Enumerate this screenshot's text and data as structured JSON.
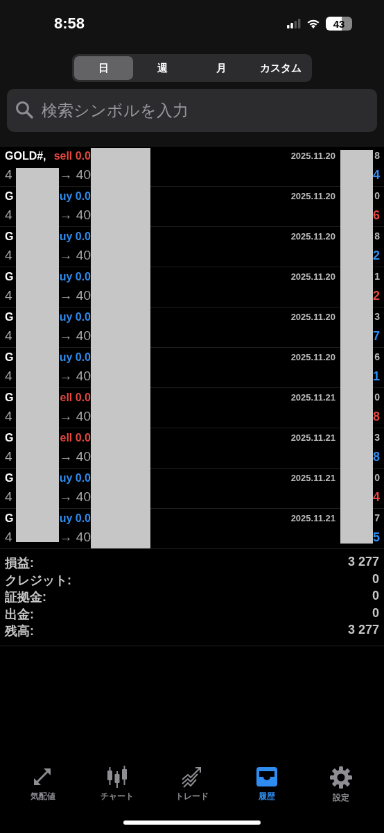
{
  "status_bar": {
    "time": "8:58",
    "battery": "43"
  },
  "period_tabs": [
    {
      "label": "日",
      "selected": true
    },
    {
      "label": "週",
      "selected": false
    },
    {
      "label": "月",
      "selected": false
    },
    {
      "label": "カスタム",
      "selected": false
    }
  ],
  "search": {
    "placeholder": "検索シンボルを入力"
  },
  "deals": [
    {
      "symbol": "GOLD#,",
      "type": "sell 0.0",
      "sell": true,
      "price_open": "4",
      "price_close": "→ 40",
      "date": "2025.11.20",
      "column_4": "8",
      "profit": "4",
      "loss": false
    },
    {
      "symbol": "G",
      "type": "uy 0.0",
      "sell": false,
      "price_open": "4",
      "price_close": "→ 40",
      "date": "2025.11.20",
      "column_4": "0",
      "profit": "6",
      "loss": true
    },
    {
      "symbol": "G",
      "type": "uy 0.0",
      "sell": false,
      "price_open": "4",
      "price_close": "→ 40",
      "date": "2025.11.20",
      "column_4": "8",
      "profit": "2",
      "loss": false
    },
    {
      "symbol": "G",
      "type": "uy 0.0",
      "sell": false,
      "price_open": "4",
      "price_close": "→ 40",
      "date": "2025.11.20",
      "column_4": "1",
      "profit": "2",
      "loss": true
    },
    {
      "symbol": "G",
      "type": "uy 0.0",
      "sell": false,
      "price_open": "4",
      "price_close": "→ 40",
      "date": "2025.11.20",
      "column_4": "3",
      "profit": "7",
      "loss": false
    },
    {
      "symbol": "G",
      "type": "uy 0.0",
      "sell": false,
      "price_open": "4",
      "price_close": "→ 40",
      "date": "2025.11.20",
      "column_4": "6",
      "profit": "1",
      "loss": false
    },
    {
      "symbol": "G",
      "type": "ell 0.0",
      "sell": true,
      "price_open": "4",
      "price_close": "→ 40",
      "date": "2025.11.21",
      "column_4": "0",
      "profit": "8",
      "loss": true
    },
    {
      "symbol": "G",
      "type": "ell 0.0",
      "sell": true,
      "price_open": "4",
      "price_close": "→ 40",
      "date": "2025.11.21",
      "column_4": "3",
      "profit": "8",
      "loss": false
    },
    {
      "symbol": "G",
      "type": "uy 0.0",
      "sell": false,
      "price_open": "4",
      "price_close": "→ 40",
      "date": "2025.11.21",
      "column_4": "0",
      "profit": "4",
      "loss": true
    },
    {
      "symbol": "G",
      "type": "uy 0.0",
      "sell": false,
      "price_open": "4",
      "price_close": "→ 40",
      "date": "2025.11.21",
      "column_4": "7",
      "profit": "5",
      "loss": false
    }
  ],
  "summary": [
    {
      "label": "損益:",
      "value": "3 277"
    },
    {
      "label": "クレジット:",
      "value": "0"
    },
    {
      "label": "証拠金:",
      "value": "0"
    },
    {
      "label": "出金:",
      "value": "0"
    },
    {
      "label": "残高:",
      "value": "3 277"
    }
  ],
  "tab_bar": [
    {
      "kind": "quotes",
      "label": "気配値",
      "selected": false
    },
    {
      "kind": "chart",
      "label": "チャート",
      "selected": false
    },
    {
      "kind": "trade",
      "label": "トレード",
      "selected": false
    },
    {
      "kind": "history",
      "label": "履歴",
      "selected": true
    },
    {
      "kind": "settings",
      "label": "設定",
      "selected": false
    }
  ]
}
